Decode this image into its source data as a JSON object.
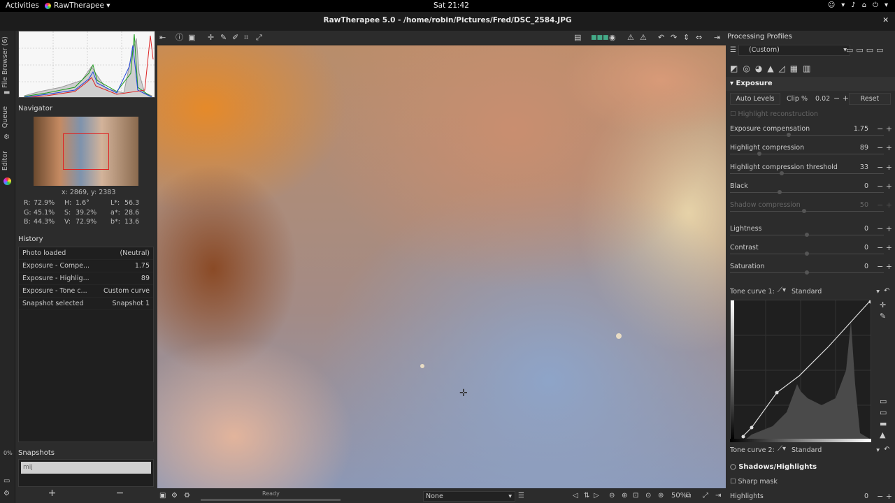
{
  "topbar": {
    "activities": "Activities",
    "app": "RawTherapee ▾",
    "clock": "Sat 21:42",
    "tray": [
      "☺",
      "▾",
      "♪",
      "⌂",
      "⏻",
      "▾"
    ]
  },
  "window": {
    "title": "RawTherapee 5.0 - /home/robin/Pictures/Fred/DSC_2584.JPG",
    "close": "✕"
  },
  "vtabs": {
    "file_browser": "File Browser (6)",
    "queue": "Queue",
    "editor": "Editor"
  },
  "navigator": {
    "title": "Navigator",
    "coords": "x: 2869, y: 2383"
  },
  "pixel_info": [
    [
      "R:",
      "72.9%",
      "H:",
      "1.6°",
      "L*:",
      "56.3"
    ],
    [
      "G:",
      "45.1%",
      "S:",
      "39.2%",
      "a*:",
      "28.6"
    ],
    [
      "B:",
      "44.3%",
      "V:",
      "72.9%",
      "b*:",
      "13.6"
    ]
  ],
  "history": {
    "title": "History",
    "rows": [
      [
        "Photo loaded",
        "(Neutral)"
      ],
      [
        "Exposure - Compe...",
        "1.75"
      ],
      [
        "Exposure - Highlig...",
        "89"
      ],
      [
        "Exposure - Tone c...",
        "Custom curve"
      ],
      [
        "Snapshot selected",
        "Snapshot 1"
      ]
    ]
  },
  "snapshots": {
    "title": "Snapshots",
    "item": "mij",
    "add": "+",
    "remove": "−",
    "pct": "0%"
  },
  "status": {
    "ready": "Ready",
    "none": "None",
    "zoom": "50%"
  },
  "right": {
    "profiles_title": "Processing Profiles",
    "profile_value": "(Custom)",
    "exposure_title": "Exposure",
    "auto_levels": "Auto Levels",
    "clip_label": "Clip %",
    "clip_value": "0.02",
    "reset": "Reset",
    "highlight_recon": "Highlight reconstruction",
    "sliders": [
      {
        "label": "Exposure compensation",
        "value": "1.75",
        "pos": 0.38
      },
      {
        "label": "Highlight compression",
        "value": "89",
        "pos": 0.18
      },
      {
        "label": "Highlight compression threshold",
        "value": "33",
        "pos": 0.33
      },
      {
        "label": "Black",
        "value": "0",
        "pos": 0.32
      },
      {
        "label": "Shadow compression",
        "value": "50",
        "pos": 0.48,
        "dim": true
      },
      {
        "label": "Lightness",
        "value": "0",
        "pos": 0.5
      },
      {
        "label": "Contrast",
        "value": "0",
        "pos": 0.5
      },
      {
        "label": "Saturation",
        "value": "0",
        "pos": 0.5
      }
    ],
    "tone1_label": "Tone curve 1:",
    "tone1_mode": "Standard",
    "tone2_label": "Tone curve 2:",
    "tone2_mode": "Standard",
    "shadows_title": "Shadows/Highlights",
    "sharp_mask": "Sharp mask",
    "highlights_label": "Highlights",
    "highlights_value": "0"
  }
}
